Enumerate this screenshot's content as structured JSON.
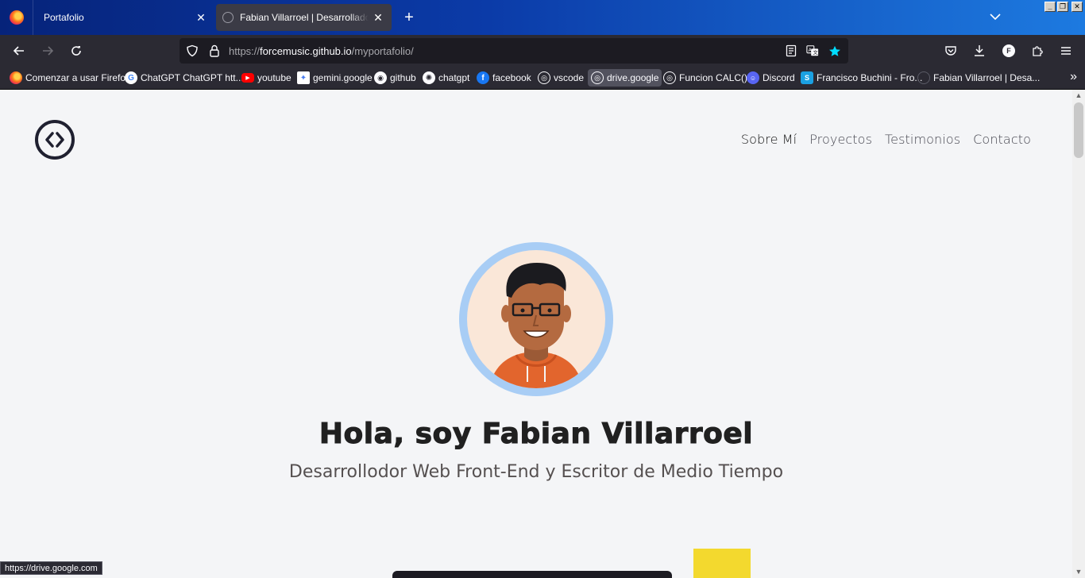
{
  "browser": {
    "tabs": [
      {
        "title": "Portafolio"
      },
      {
        "title": "Fabian Villarroel | Desarrollador Web Front-End"
      }
    ],
    "url": {
      "prefix": "https://",
      "host": "forcemusic.github.io",
      "path": "/myportafolio/"
    },
    "bookmarks": [
      {
        "label": "Comenzar a usar Firefox",
        "icon": "firefox-icon"
      },
      {
        "label": "ChatGPT ChatGPT htt...",
        "icon": "google-icon"
      },
      {
        "label": "youtube",
        "icon": "youtube-icon"
      },
      {
        "label": "gemini.google",
        "icon": "gemini-icon"
      },
      {
        "label": "github",
        "icon": "github-icon"
      },
      {
        "label": "chatgpt",
        "icon": "chatgpt-icon"
      },
      {
        "label": "facebook",
        "icon": "facebook-icon"
      },
      {
        "label": "vscode",
        "icon": "globe-icon"
      },
      {
        "label": "drive.google",
        "icon": "globe-icon"
      },
      {
        "label": "Funcion CALC()",
        "icon": "globe-icon"
      },
      {
        "label": "Discord",
        "icon": "discord-icon"
      },
      {
        "label": "Francisco Buchini - Fro...",
        "icon": "site-icon"
      },
      {
        "label": "Fabian Villarroel | Desa...",
        "icon": "portfolio-icon"
      }
    ],
    "status_url": "https://drive.google.com",
    "account_initial": "F"
  },
  "site": {
    "nav": [
      {
        "label": "Sobre Mí"
      },
      {
        "label": "Proyectos"
      },
      {
        "label": "Testimonios"
      },
      {
        "label": "Contacto"
      }
    ],
    "hero": {
      "title": "Hola, soy Fabian Villarroel",
      "subtitle": "Desarrollodor Web Front-End y Escritor de Medio Tiempo"
    }
  },
  "colors": {
    "tab_gradient_start": "#06237a",
    "tab_gradient_end": "#1d7ae0",
    "toolbar": "#2b2a33",
    "page_bg": "#f4f5f7",
    "avatar_ring": "#a8cdf5",
    "accent_yellow": "#f3d92e"
  }
}
